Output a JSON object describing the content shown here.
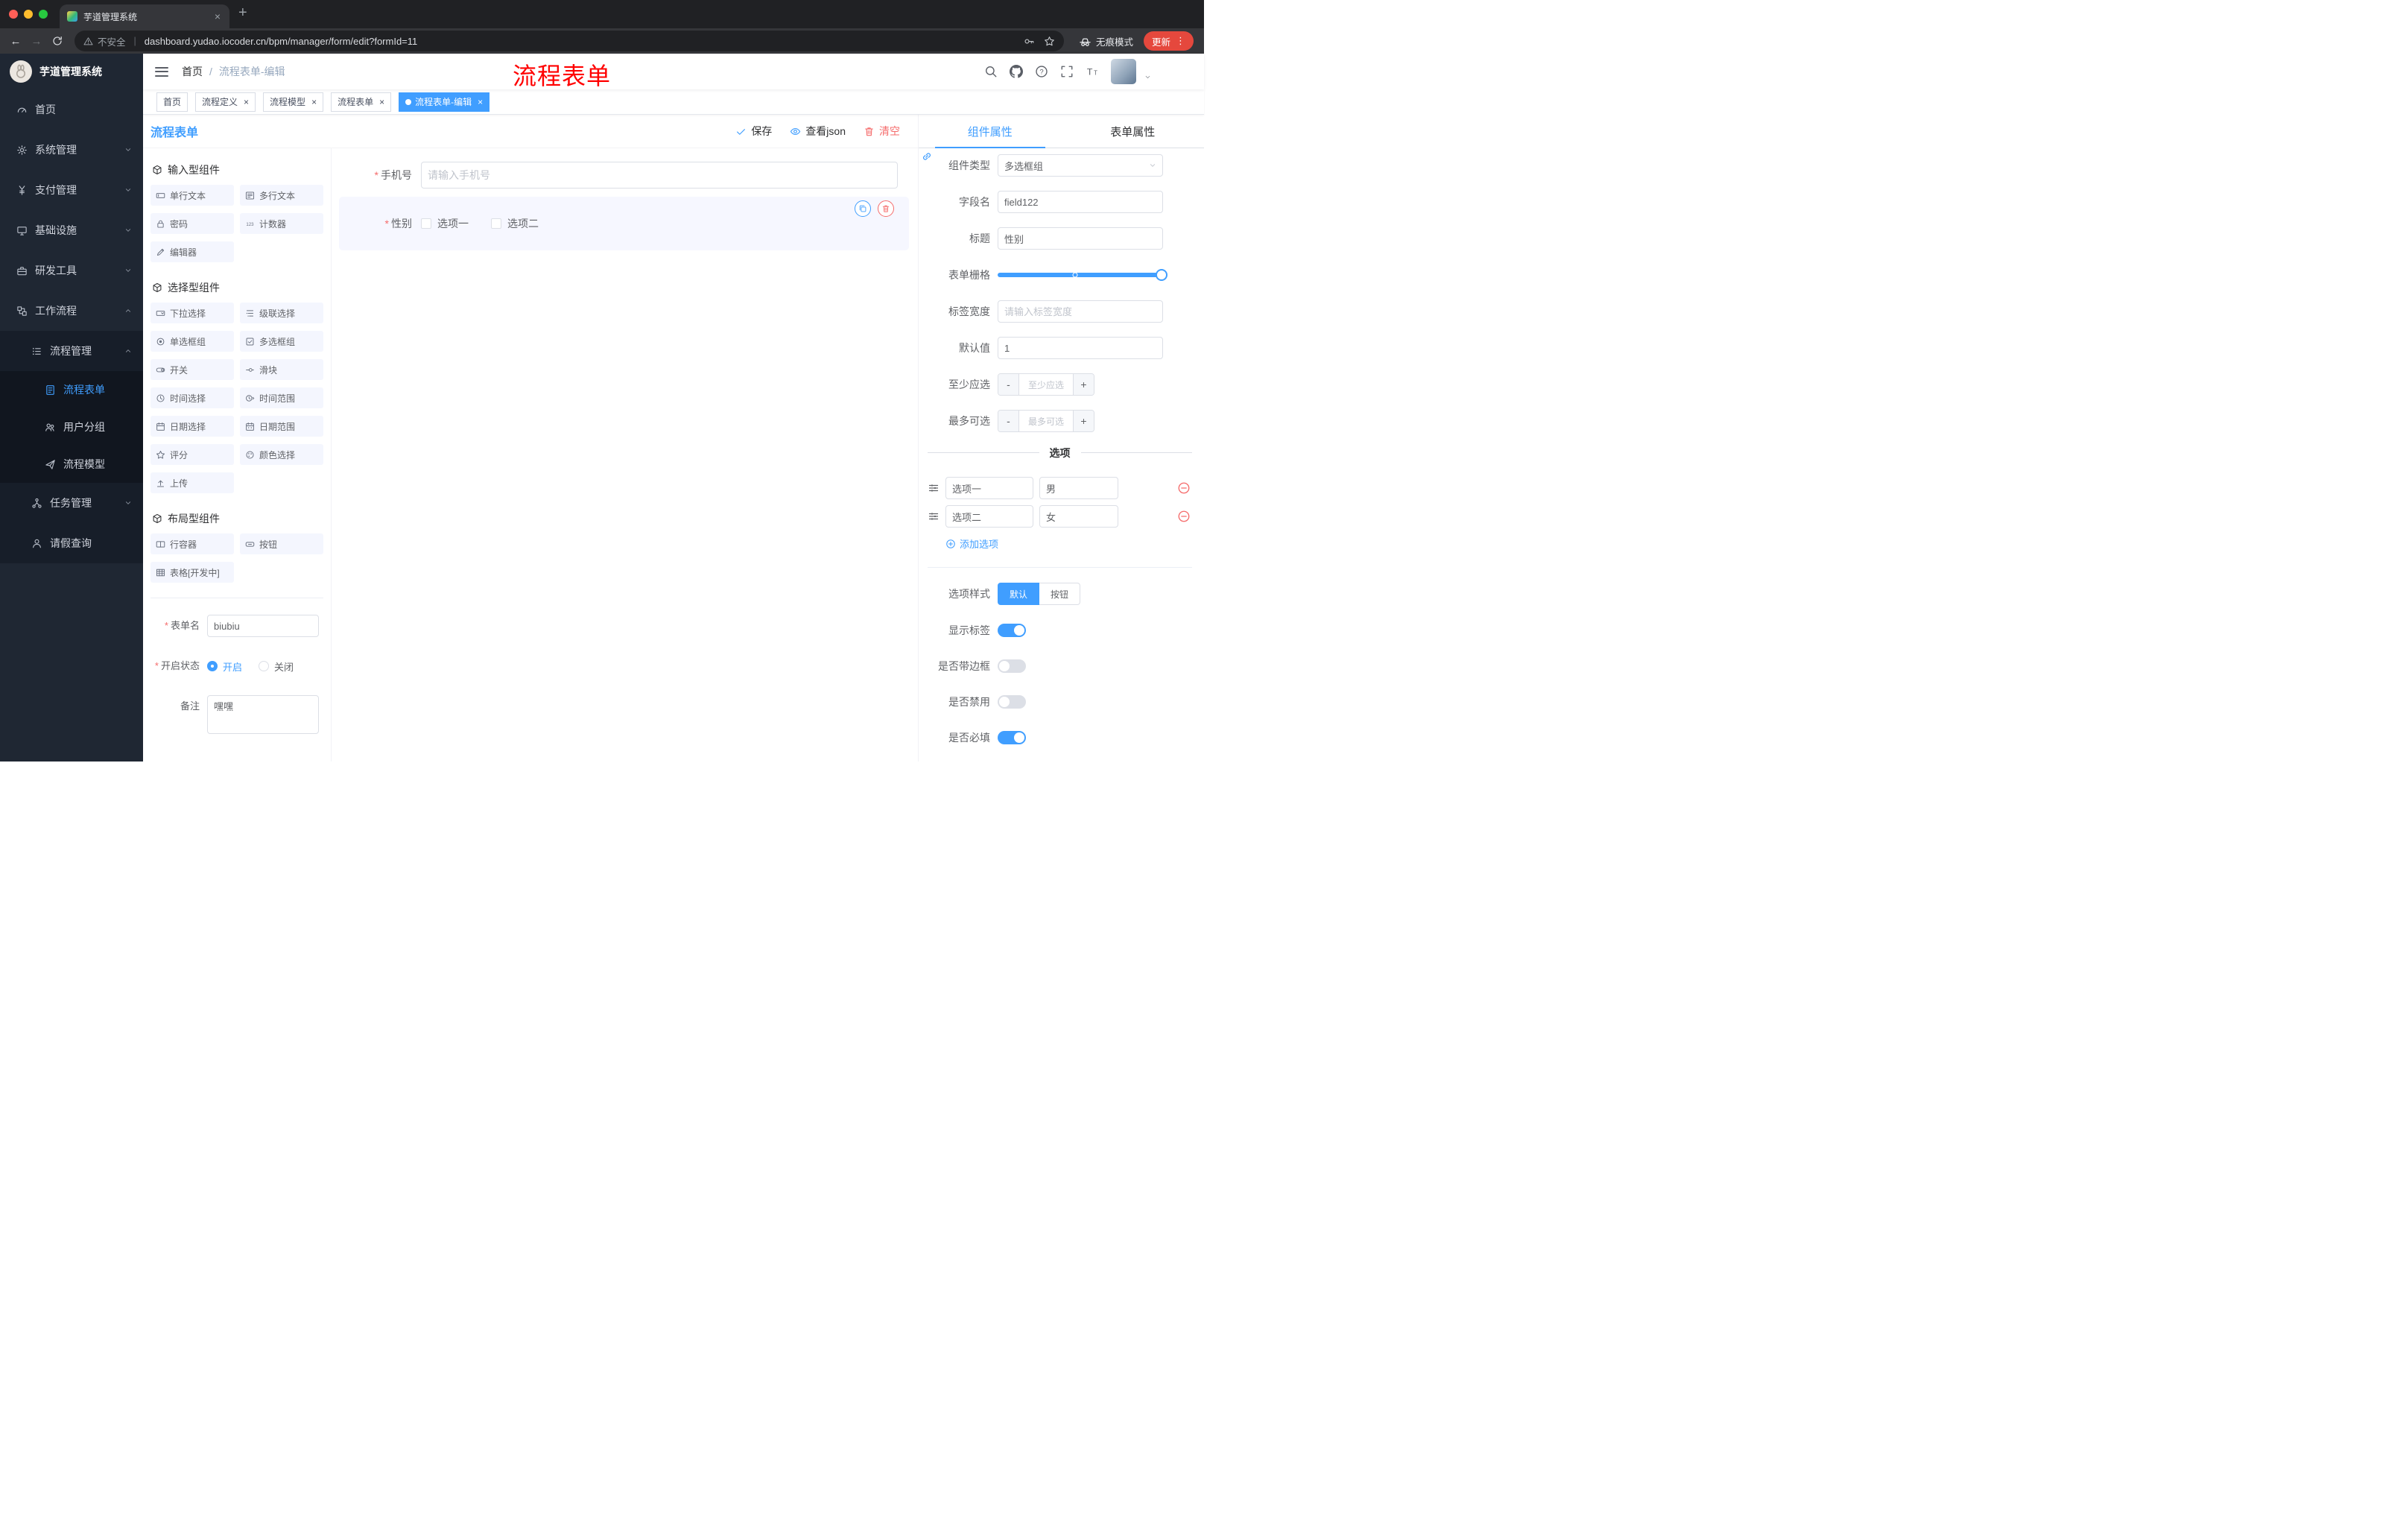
{
  "colors": {
    "accent": "#409EFF",
    "danger": "#F56C6C",
    "sidebar_bg": "#1f2733",
    "update_button_bg": "#E5483D"
  },
  "browser": {
    "tab_title": "芋道管理系统",
    "security_label": "不安全",
    "url": "dashboard.yudao.iocoder.cn/bpm/manager/form/edit?formId=11",
    "incognito_label": "无痕模式",
    "update_label": "更新",
    "icons": [
      "back-icon",
      "forward-icon",
      "reload-icon",
      "warning-icon",
      "key-icon",
      "bookmark-star-icon",
      "incognito-icon",
      "kebab-menu-icon",
      "new-tab-icon",
      "tab-close-icon"
    ]
  },
  "sidebar": {
    "title": "芋道管理系统",
    "menu": [
      {
        "label": "首页",
        "icon": "dashboard-icon"
      },
      {
        "label": "系统管理",
        "icon": "gear-icon",
        "state": "collapsed"
      },
      {
        "label": "支付管理",
        "icon": "yen-icon",
        "state": "collapsed"
      },
      {
        "label": "基础设施",
        "icon": "monitor-icon",
        "state": "collapsed"
      },
      {
        "label": "研发工具",
        "icon": "toolbox-icon",
        "state": "collapsed"
      },
      {
        "label": "工作流程",
        "icon": "workflow-icon",
        "state": "expanded"
      }
    ],
    "process_group": {
      "label": "流程管理",
      "icon": "list-icon",
      "state": "expanded"
    },
    "process_children": [
      {
        "label": "流程表单",
        "icon": "form-icon",
        "active": true
      },
      {
        "label": "用户分组",
        "icon": "users-icon"
      },
      {
        "label": "流程模型",
        "icon": "send-icon"
      }
    ],
    "after_group": [
      {
        "label": "任务管理",
        "icon": "tree-icon",
        "state": "collapsed"
      },
      {
        "label": "请假查询",
        "icon": "person-icon"
      }
    ]
  },
  "navbar": {
    "breadcrumb": {
      "home": "首页",
      "sep": "/",
      "current": "流程表单-编辑"
    },
    "watermark": "流程表单",
    "icons": [
      "hamburger-icon",
      "search-icon",
      "github-icon",
      "help-icon",
      "fullscreen-icon",
      "font-size-icon",
      "avatar",
      "caret-down-icon"
    ]
  },
  "tags": [
    {
      "label": "首页",
      "closable": false,
      "active": false
    },
    {
      "label": "流程定义",
      "closable": true,
      "active": false
    },
    {
      "label": "流程模型",
      "closable": true,
      "active": false
    },
    {
      "label": "流程表单",
      "closable": true,
      "active": false
    },
    {
      "label": "流程表单-编辑",
      "closable": true,
      "active": true
    }
  ],
  "designer": {
    "title": "流程表单",
    "save": "保存",
    "view_json": "查看json",
    "clear": "清空",
    "groups": [
      {
        "title": "输入型组件",
        "items": [
          {
            "label": "单行文本",
            "icon": "text-field-icon"
          },
          {
            "label": "多行文本",
            "icon": "textarea-icon"
          },
          {
            "label": "密码",
            "icon": "lock-icon"
          },
          {
            "label": "计数器",
            "icon": "counter-icon"
          },
          {
            "label": "编辑器",
            "icon": "editor-icon"
          }
        ]
      },
      {
        "title": "选择型组件",
        "items": [
          {
            "label": "下拉选择",
            "icon": "select-icon"
          },
          {
            "label": "级联选择",
            "icon": "cascader-icon"
          },
          {
            "label": "单选框组",
            "icon": "radio-icon"
          },
          {
            "label": "多选框组",
            "icon": "checkbox-icon"
          },
          {
            "label": "开关",
            "icon": "switch-icon"
          },
          {
            "label": "滑块",
            "icon": "slider-icon"
          },
          {
            "label": "时间选择",
            "icon": "time-icon"
          },
          {
            "label": "时间范围",
            "icon": "time-range-icon"
          },
          {
            "label": "日期选择",
            "icon": "date-icon"
          },
          {
            "label": "日期范围",
            "icon": "date-range-icon"
          },
          {
            "label": "评分",
            "icon": "rate-icon"
          },
          {
            "label": "颜色选择",
            "icon": "color-icon"
          },
          {
            "label": "上传",
            "icon": "upload-icon"
          }
        ]
      },
      {
        "title": "布局型组件",
        "items": [
          {
            "label": "行容器",
            "icon": "row-container-icon"
          },
          {
            "label": "按钮",
            "icon": "button-icon"
          },
          {
            "label": "表格[开发中]",
            "icon": "table-icon"
          }
        ]
      }
    ],
    "meta_form": {
      "name_label": "表单名",
      "name_value": "biubiu",
      "status_label": "开启状态",
      "status_on": "开启",
      "status_off": "关闭",
      "status_selected": "开启",
      "remark_label": "备注",
      "remark_value": "嘿嘿"
    },
    "canvas": {
      "phone_label": "手机号",
      "phone_placeholder": "请输入手机号",
      "gender_label": "性别",
      "gender_options": [
        "选项一",
        "选项二"
      ]
    }
  },
  "props": {
    "tab_component": "组件属性",
    "tab_form": "表单属性",
    "type_label": "组件类型",
    "type_value": "多选框组",
    "field_label": "字段名",
    "field_value": "field122",
    "title_label": "标题",
    "title_value": "性别",
    "grid_label": "表单栅格",
    "width_label": "标签宽度",
    "width_placeholder": "请输入标签宽度",
    "default_label": "默认值",
    "default_value": "1",
    "min_label": "至少应选",
    "min_placeholder": "至少应选",
    "max_label": "最多可选",
    "max_placeholder": "最多可选",
    "options_title": "选项",
    "options": [
      {
        "label": "选项一",
        "value": "男"
      },
      {
        "label": "选项二",
        "value": "女"
      }
    ],
    "add_option": "添加选项",
    "style_label": "选项样式",
    "style_default": "默认",
    "style_button": "按钮",
    "style_selected": "默认",
    "switches": [
      {
        "label": "显示标签",
        "on": true
      },
      {
        "label": "是否带边框",
        "on": false
      },
      {
        "label": "是否禁用",
        "on": false
      },
      {
        "label": "是否必填",
        "on": true
      }
    ]
  }
}
